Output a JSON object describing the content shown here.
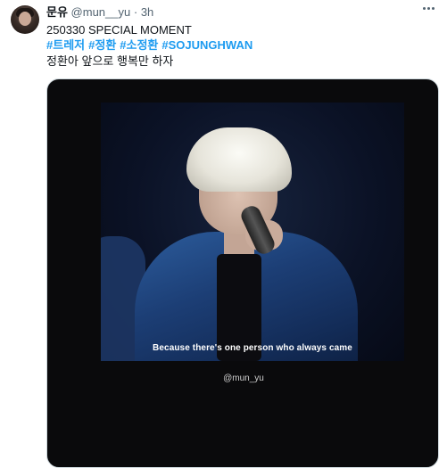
{
  "tweet": {
    "display_name": "문유",
    "handle": "@mun__yu",
    "separator": "·",
    "time": "3h",
    "line1": "250330 SPECIAL MOMENT",
    "hashtags": [
      "#트레저",
      "#정환",
      "#소정환",
      "#SOJUNGHWAN"
    ],
    "line3": "정환아 앞으로 행복만 하자"
  },
  "media": {
    "subtitle": "Because there's one person who always came",
    "watermark": "@mun_yu"
  },
  "icons": {
    "more": "more-horizontal-icon",
    "avatar": "avatar"
  },
  "colors": {
    "link": "#1d9bf0",
    "secondary_text": "#536471",
    "primary_text": "#0f1419"
  }
}
